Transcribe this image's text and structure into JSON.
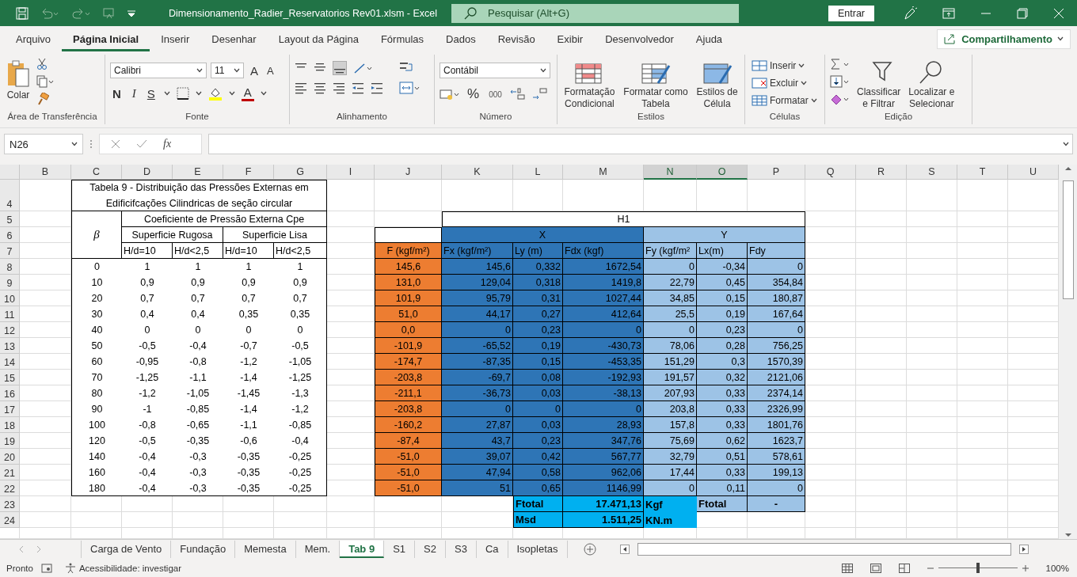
{
  "title_bar": {
    "title": "Dimensionamento_Radier_Reservatorios Rev01.xlsm  -  Excel",
    "search_placeholder": "Pesquisar (Alt+G)",
    "sign_in": "Entrar"
  },
  "menu_tabs": [
    {
      "label": "Arquivo",
      "selected": false
    },
    {
      "label": "Página Inicial",
      "selected": true
    },
    {
      "label": "Inserir",
      "selected": false
    },
    {
      "label": "Desenhar",
      "selected": false
    },
    {
      "label": "Layout da Página",
      "selected": false
    },
    {
      "label": "Fórmulas",
      "selected": false
    },
    {
      "label": "Dados",
      "selected": false
    },
    {
      "label": "Revisão",
      "selected": false
    },
    {
      "label": "Exibir",
      "selected": false
    },
    {
      "label": "Desenvolvedor",
      "selected": false
    },
    {
      "label": "Ajuda",
      "selected": false
    }
  ],
  "share_button": "Compartilhamento",
  "ribbon": {
    "groups": [
      {
        "kind": "clipboard",
        "label": "Área de Transferência",
        "paste": "Colar"
      },
      {
        "kind": "font",
        "label": "Fonte",
        "font_name": "Calibri",
        "font_size": "11",
        "grow": "A",
        "shrink": "A",
        "bold": "N",
        "italic": "I",
        "underline": "S",
        "font_color": "A"
      },
      {
        "kind": "alignment",
        "label": "Alinhamento"
      },
      {
        "kind": "number",
        "label": "Número",
        "format": "Contábil",
        "percent": "%",
        "thousands": "000"
      },
      {
        "kind": "styles",
        "label": "Estilos",
        "buttons": [
          [
            "Formatação",
            "Condicional"
          ],
          [
            "Formatar como",
            "Tabela"
          ],
          [
            "Estilos de",
            "Célula"
          ]
        ]
      },
      {
        "kind": "cells",
        "label": "Células",
        "buttons": [
          "Inserir",
          "Excluir",
          "Formatar"
        ]
      },
      {
        "kind": "editing",
        "label": "Edição",
        "buttons": [
          [
            "Classificar",
            "e Filtrar"
          ],
          [
            "Localizar e",
            "Selecionar"
          ]
        ]
      }
    ]
  },
  "formula_bar": {
    "name_box": "N26",
    "fx": "fx"
  },
  "sheet": {
    "columns": [
      {
        "letter": "B",
        "selected": false
      },
      {
        "letter": "C",
        "selected": false
      },
      {
        "letter": "D",
        "selected": false
      },
      {
        "letter": "E",
        "selected": false
      },
      {
        "letter": "F",
        "selected": false
      },
      {
        "letter": "G",
        "selected": false
      },
      {
        "letter": "I",
        "selected": false
      },
      {
        "letter": "J",
        "selected": false
      },
      {
        "letter": "K",
        "selected": false
      },
      {
        "letter": "L",
        "selected": false
      },
      {
        "letter": "M",
        "selected": false
      },
      {
        "letter": "N",
        "selected": true
      },
      {
        "letter": "O",
        "selected": true
      },
      {
        "letter": "P",
        "selected": false
      },
      {
        "letter": "Q",
        "selected": false
      },
      {
        "letter": "R",
        "selected": false
      },
      {
        "letter": "S",
        "selected": false
      },
      {
        "letter": "T",
        "selected": false
      },
      {
        "letter": "U",
        "selected": false
      }
    ],
    "rows": [
      "4",
      "5",
      "6",
      "7",
      "8",
      "9",
      "10",
      "11",
      "12",
      "13",
      "14",
      "15",
      "16",
      "17",
      "18",
      "19",
      "20",
      "21",
      "22",
      "23",
      "24"
    ],
    "coefficient_table": {
      "title": "Tabela 9 - Distribuição das Pressões Externas em Edificifcações Cilindricas de seção circular",
      "beta": "β",
      "group_header": "Coeficiente de Pressão Externa Cpe",
      "subgroups": [
        "Superficie Rugosa",
        "Superficie Lisa"
      ],
      "ratios": [
        "H/d=10",
        "H/d<2,5",
        "H/d=10",
        "H/d<2,5"
      ],
      "rows": [
        [
          "0",
          "1",
          "1",
          "1",
          "1"
        ],
        [
          "10",
          "0,9",
          "0,9",
          "0,9",
          "0,9"
        ],
        [
          "20",
          "0,7",
          "0,7",
          "0,7",
          "0,7"
        ],
        [
          "30",
          "0,4",
          "0,4",
          "0,35",
          "0,35"
        ],
        [
          "40",
          "0",
          "0",
          "0",
          "0"
        ],
        [
          "50",
          "-0,5",
          "-0,4",
          "-0,7",
          "-0,5"
        ],
        [
          "60",
          "-0,95",
          "-0,8",
          "-1,2",
          "-1,05"
        ],
        [
          "70",
          "-1,25",
          "-1,1",
          "-1,4",
          "-1,25"
        ],
        [
          "80",
          "-1,2",
          "-1,05",
          "-1,45",
          "-1,3"
        ],
        [
          "90",
          "-1",
          "-0,85",
          "-1,4",
          "-1,2"
        ],
        [
          "100",
          "-0,8",
          "-0,65",
          "-1,1",
          "-0,85"
        ],
        [
          "120",
          "-0,5",
          "-0,35",
          "-0,6",
          "-0,4"
        ],
        [
          "140",
          "-0,4",
          "-0,3",
          "-0,35",
          "-0,25"
        ],
        [
          "160",
          "-0,4",
          "-0,3",
          "-0,35",
          "-0,25"
        ],
        [
          "180",
          "-0,4",
          "-0,3",
          "-0,35",
          "-0,25"
        ]
      ]
    },
    "forces_table": {
      "title": "H1",
      "x_header": "X",
      "y_header": "Y",
      "columns": [
        "F (kgf/m²)",
        "Fx (kgf/m²)",
        "Ly (m)",
        "Fdx (kgf)",
        "Fy (kgf/m²",
        "Lx(m)",
        "Fdy"
      ],
      "rows": [
        [
          "145,6",
          "145,6",
          "0,332",
          "1672,54",
          "0",
          "-0,34",
          "0"
        ],
        [
          "131,0",
          "129,04",
          "0,318",
          "1419,8",
          "22,79",
          "0,45",
          "354,84"
        ],
        [
          "101,9",
          "95,79",
          "0,31",
          "1027,44",
          "34,85",
          "0,15",
          "180,87"
        ],
        [
          "51,0",
          "44,17",
          "0,27",
          "412,64",
          "25,5",
          "0,19",
          "167,64"
        ],
        [
          "0,0",
          "0",
          "0,23",
          "0",
          "0",
          "0,23",
          "0"
        ],
        [
          "-101,9",
          "-65,52",
          "0,19",
          "-430,73",
          "78,06",
          "0,28",
          "756,25"
        ],
        [
          "-174,7",
          "-87,35",
          "0,15",
          "-453,35",
          "151,29",
          "0,3",
          "1570,39"
        ],
        [
          "-203,8",
          "-69,7",
          "0,08",
          "-192,93",
          "191,57",
          "0,32",
          "2121,06"
        ],
        [
          "-211,1",
          "-36,73",
          "0,03",
          "-38,13",
          "207,93",
          "0,33",
          "2374,14"
        ],
        [
          "-203,8",
          "0",
          "0",
          "0",
          "203,8",
          "0,33",
          "2326,99"
        ],
        [
          "-160,2",
          "27,87",
          "0,03",
          "28,93",
          "157,8",
          "0,33",
          "1801,76"
        ],
        [
          "-87,4",
          "43,7",
          "0,23",
          "347,76",
          "75,69",
          "0,62",
          "1623,7"
        ],
        [
          "-51,0",
          "39,07",
          "0,42",
          "567,77",
          "32,79",
          "0,51",
          "578,61"
        ],
        [
          "-51,0",
          "47,94",
          "0,58",
          "962,06",
          "17,44",
          "0,33",
          "199,13"
        ],
        [
          "-51,0",
          "51",
          "0,65",
          "1146,99",
          "0",
          "0,11",
          "0"
        ]
      ],
      "totals": [
        {
          "label": "Ftotal",
          "value": "17.471,13",
          "unit": "Kgf"
        },
        {
          "label": "Msd",
          "value": "1.511,25",
          "unit": "KN.m"
        }
      ],
      "y_total": {
        "label": "Ftotal",
        "value": "-"
      }
    }
  },
  "sheet_tabs": [
    {
      "label": "Carga de Vento",
      "selected": false
    },
    {
      "label": "Fundação",
      "selected": false
    },
    {
      "label": "Memesta",
      "selected": false
    },
    {
      "label": "Mem.",
      "selected": false
    },
    {
      "label": "Tab 9",
      "selected": true
    },
    {
      "label": "S1",
      "selected": false
    },
    {
      "label": "S2",
      "selected": false
    },
    {
      "label": "S3",
      "selected": false
    },
    {
      "label": "Ca",
      "selected": false
    },
    {
      "label": "Isopletas",
      "selected": false
    }
  ],
  "status_bar": {
    "status": "Pronto",
    "accessibility": "Acessibilidade: investigar",
    "zoom": "100%",
    "zoom_level": {
      "level": 0.5
    }
  }
}
